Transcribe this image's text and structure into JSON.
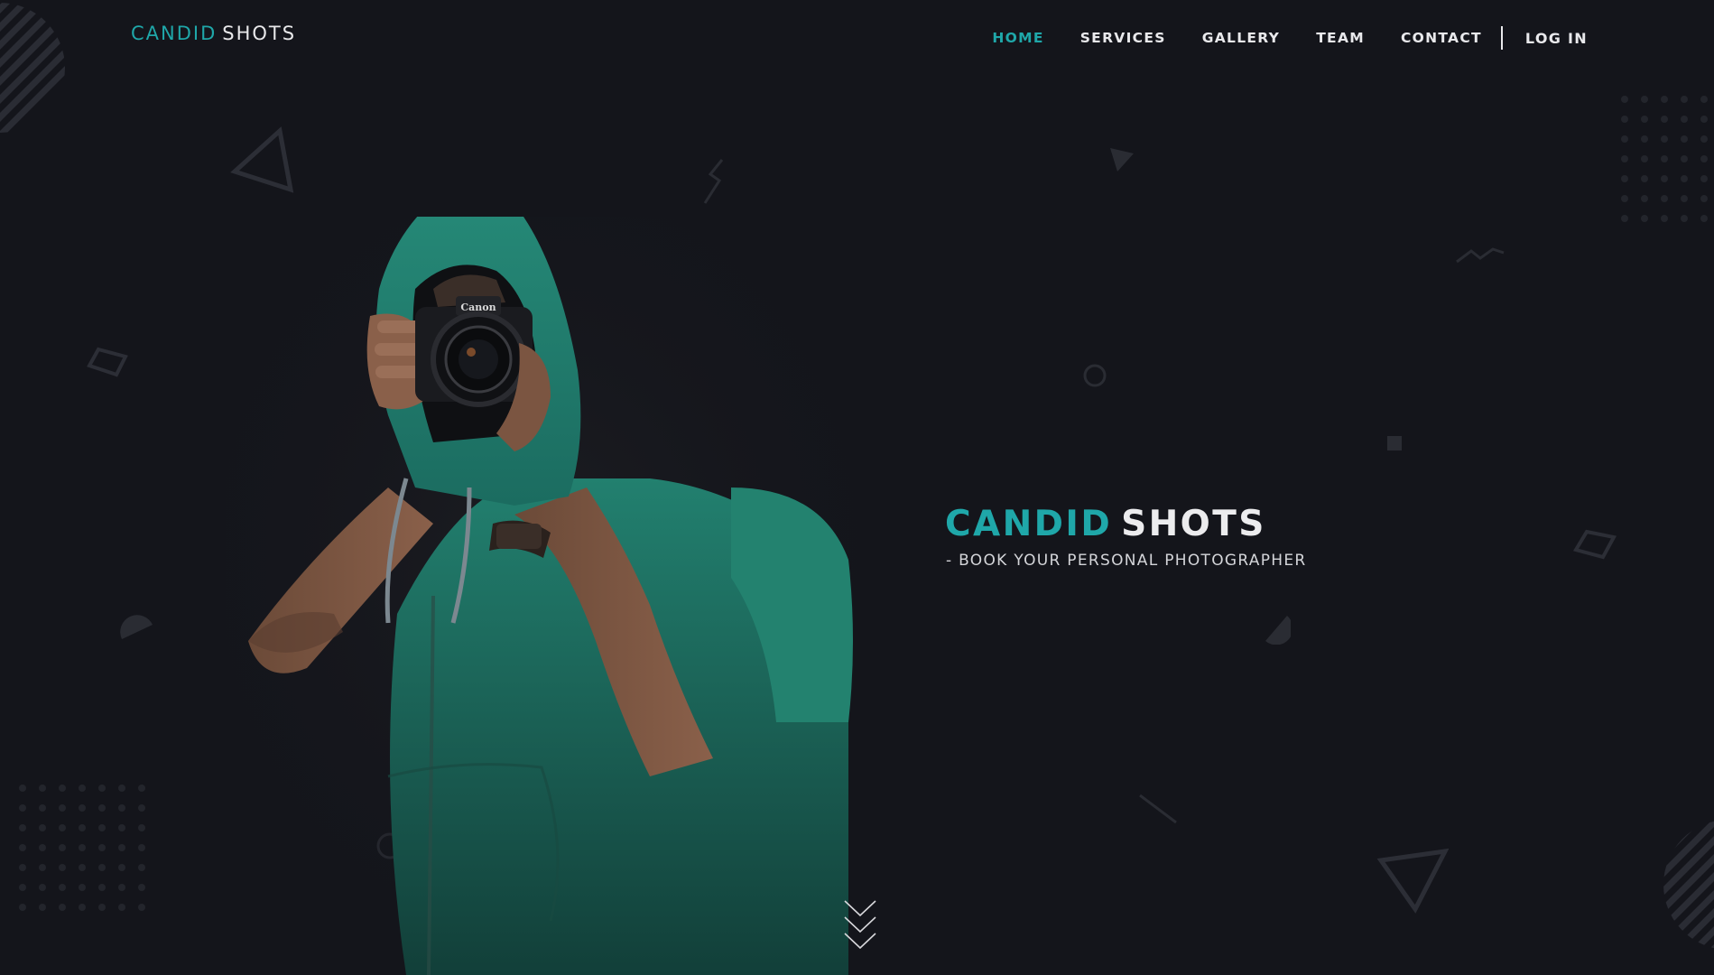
{
  "brand": {
    "accent": "CANDID",
    "rest": "SHOTS"
  },
  "nav": {
    "items": [
      {
        "label": "HOME",
        "active": true
      },
      {
        "label": "SERVICES",
        "active": false
      },
      {
        "label": "GALLERY",
        "active": false
      },
      {
        "label": "TEAM",
        "active": false
      },
      {
        "label": "CONTACT",
        "active": false
      }
    ],
    "login": "LOG IN"
  },
  "hero": {
    "title_accent": "CANDID",
    "title_rest": "SHOTS",
    "subtitle": "- BOOK YOUR PERSONAL PHOTOGRAPHER",
    "camera_brand": "Canon"
  },
  "icons": {
    "scroll": "chevrons-down-icon"
  },
  "colors": {
    "background": "#14151b",
    "accent": "#1fa7a9",
    "hoodie": "#1f7e6e",
    "text": "#ececee"
  }
}
